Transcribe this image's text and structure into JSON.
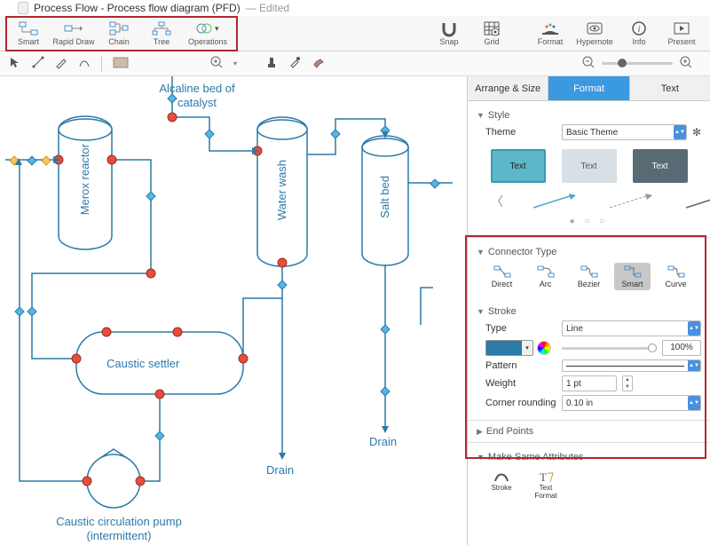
{
  "titlebar": {
    "title": "Process Flow - Process flow diagram (PFD)",
    "edited": "— Edited"
  },
  "toolbar": {
    "smart": "Smart",
    "rapid_draw": "Rapid Draw",
    "chain": "Chain",
    "tree": "Tree",
    "operations": "Operations",
    "snap": "Snap",
    "grid": "Grid",
    "format": "Format",
    "hypernote": "Hypernote",
    "info": "Info",
    "present": "Present"
  },
  "canvas": {
    "alcaline": "Alcaline bed of\ncatalyst",
    "merox": "Merox reactor",
    "water_wash": "Water wash",
    "salt_bed": "Salt bed",
    "caustic_settler": "Caustic settler",
    "drain1": "Drain",
    "drain2": "Drain",
    "pump": "Caustic circulation pump\n(intermittent)"
  },
  "sidebar": {
    "tabs": {
      "arrange": "Arrange & Size",
      "format": "Format",
      "text": "Text"
    },
    "style": {
      "header": "Style",
      "theme_label": "Theme",
      "theme_value": "Basic Theme",
      "text": "Text"
    },
    "connector": {
      "header": "Connector Type",
      "direct": "Direct",
      "arc": "Arc",
      "bezier": "Bezier",
      "smart": "Smart",
      "curve": "Curve"
    },
    "stroke": {
      "header": "Stroke",
      "type_label": "Type",
      "type_value": "Line",
      "opacity": "100%",
      "pattern_label": "Pattern",
      "weight_label": "Weight",
      "weight_value": "1 pt",
      "corner_label": "Corner rounding",
      "corner_value": "0.10 in"
    },
    "endpoints": {
      "header": "End Points"
    },
    "make_same": {
      "header": "Make Same Attributes",
      "stroke": "Stroke",
      "text_format": "Text\nFormat"
    }
  }
}
